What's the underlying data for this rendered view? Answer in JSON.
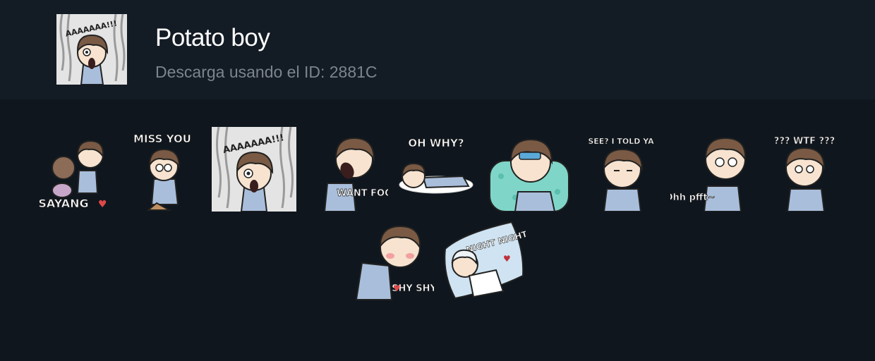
{
  "pack": {
    "title": "Potato boy",
    "subtitle": "Descarga usando el ID: 2881C",
    "cover_icon": "screaming-boy-sticker-icon"
  },
  "stickers": [
    {
      "name": "sayang-hug-sticker",
      "caption": "SAYANG"
    },
    {
      "name": "miss-you-sticker",
      "caption": "MISS YOU"
    },
    {
      "name": "screaming-sticker",
      "caption": "AAAAAAA!!!"
    },
    {
      "name": "want-food-sticker",
      "caption": "WANT FOOD"
    },
    {
      "name": "oh-why-sticker",
      "caption": "OH WHY?"
    },
    {
      "name": "sick-fever-sticker",
      "caption": ""
    },
    {
      "name": "told-you-sticker",
      "caption": "SEE? I TOLD YA"
    },
    {
      "name": "ohh-pfft-sticker",
      "caption": "Ohh pfft~"
    },
    {
      "name": "wtf-sticker",
      "caption": "??? WTF ???"
    },
    {
      "name": "shy-shy-sticker",
      "caption": "SHY SHY"
    },
    {
      "name": "night-night-sticker",
      "caption": "NIGHT NIGHT"
    }
  ],
  "colors": {
    "header_bg": "#131b24",
    "page_bg": "#0f161e",
    "hair": "#7a5a44",
    "pajama": "#a9bedb",
    "skin": "#f7e3cf"
  }
}
